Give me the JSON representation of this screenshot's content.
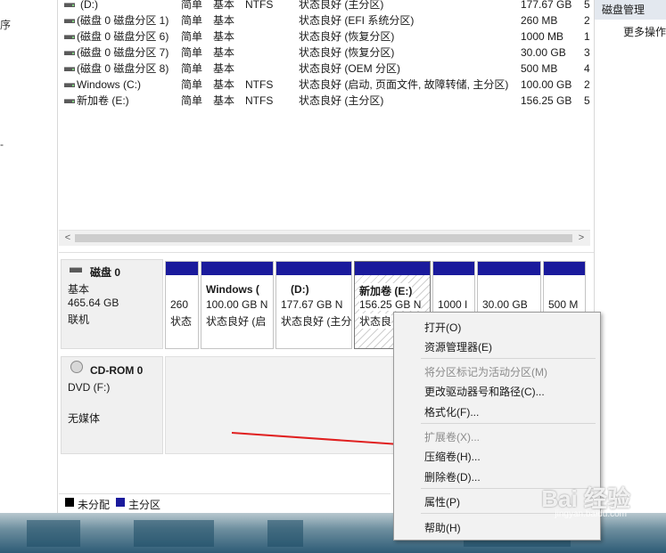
{
  "left_nav": {
    "frag1": "序",
    "frag2": "-"
  },
  "volumes": [
    {
      "name": "(D:)",
      "layout": "简单",
      "type": "基本",
      "fs": "NTFS",
      "status": "状态良好 (主分区)",
      "capacity": "177.67 GB",
      "free": "5"
    },
    {
      "name": "(磁盘 0 磁盘分区 1)",
      "layout": "简单",
      "type": "基本",
      "fs": "",
      "status": "状态良好 (EFI 系统分区)",
      "capacity": "260 MB",
      "free": "2"
    },
    {
      "name": "(磁盘 0 磁盘分区 6)",
      "layout": "简单",
      "type": "基本",
      "fs": "",
      "status": "状态良好 (恢复分区)",
      "capacity": "1000 MB",
      "free": "1"
    },
    {
      "name": "(磁盘 0 磁盘分区 7)",
      "layout": "简单",
      "type": "基本",
      "fs": "",
      "status": "状态良好 (恢复分区)",
      "capacity": "30.00 GB",
      "free": "3"
    },
    {
      "name": "(磁盘 0 磁盘分区 8)",
      "layout": "简单",
      "type": "基本",
      "fs": "",
      "status": "状态良好 (OEM 分区)",
      "capacity": "500 MB",
      "free": "4"
    },
    {
      "name": "Windows (C:)",
      "layout": "简单",
      "type": "基本",
      "fs": "NTFS",
      "status": "状态良好 (启动, 页面文件, 故障转储, 主分区)",
      "capacity": "100.00 GB",
      "free": "2"
    },
    {
      "name": "新加卷 (E:)",
      "layout": "简单",
      "type": "基本",
      "fs": "NTFS",
      "status": "状态良好 (主分区)",
      "capacity": "156.25 GB",
      "free": "5"
    }
  ],
  "scrollbar": {
    "left_arrow": "<",
    "right_arrow": ">"
  },
  "actions": {
    "title": "磁盘管理",
    "more": "更多操作"
  },
  "disk0": {
    "name": "磁盘 0",
    "type": "基本",
    "size": "465.64 GB",
    "state": "联机",
    "partitions": [
      {
        "l1": "",
        "l2": "260",
        "l3": "状态"
      },
      {
        "l1": "Windows (",
        "l2": "100.00 GB N",
        "l3": "状态良好 (启"
      },
      {
        "l1": "(D:)",
        "l2": "177.67 GB N",
        "l3": "状态良好 (主分"
      },
      {
        "l1": "新加卷 (E:)",
        "l2": "156.25 GB N",
        "l3": "状态良"
      },
      {
        "l1": "",
        "l2": "1000 I",
        "l3": ""
      },
      {
        "l1": "",
        "l2": "30.00 GB",
        "l3": ""
      },
      {
        "l1": "",
        "l2": "500 M",
        "l3": ""
      }
    ]
  },
  "cdrom0": {
    "name": "CD-ROM 0",
    "drive": "DVD (F:)",
    "media": "无媒体"
  },
  "legend": {
    "unallocated": "未分配",
    "primary": "主分区"
  },
  "context_menu": {
    "items": [
      {
        "label": "打开(O)",
        "disabled": false
      },
      {
        "label": "资源管理器(E)",
        "disabled": false
      },
      {
        "label": "将分区标记为活动分区(M)",
        "disabled": true
      },
      {
        "label": "更改驱动器号和路径(C)...",
        "disabled": false
      },
      {
        "label": "格式化(F)...",
        "disabled": false
      },
      {
        "label": "扩展卷(X)...",
        "disabled": true
      },
      {
        "label": "压缩卷(H)...",
        "disabled": false
      },
      {
        "label": "删除卷(D)...",
        "disabled": false
      },
      {
        "label": "属性(P)",
        "disabled": false
      },
      {
        "label": "帮助(H)",
        "disabled": false
      }
    ]
  },
  "watermark": {
    "brand": "Bai 经验",
    "url": "jingyan.baidu.com"
  },
  "colors": {
    "primary_partition": "#1a1a9c",
    "arrow": "#e02020",
    "unallocated": "#000000"
  }
}
